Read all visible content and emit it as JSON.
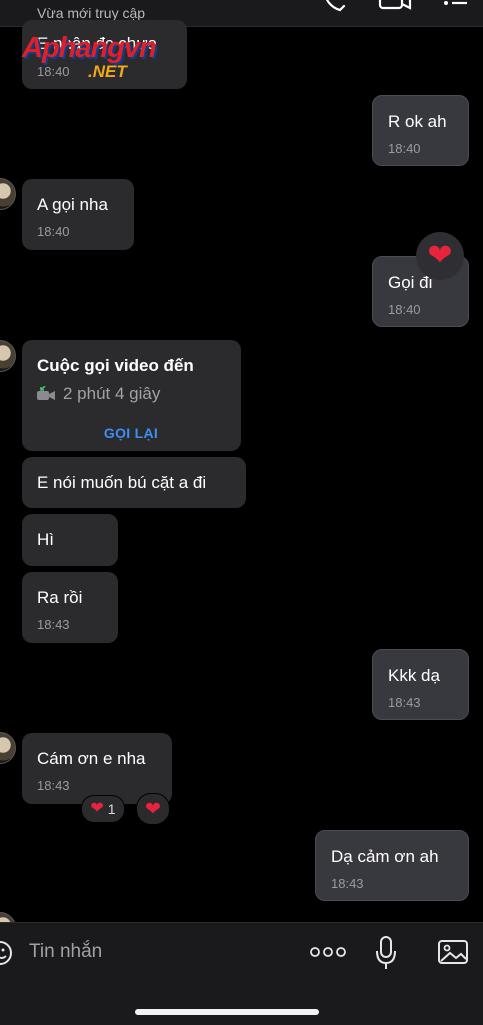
{
  "header": {
    "status": "Vừa mới truy cập",
    "icons": [
      "phone-icon",
      "video-icon",
      "more-icon"
    ]
  },
  "watermark": {
    "top": "Aphangvn",
    "bottom": ".NET"
  },
  "messages": [
    {
      "id": "m1",
      "direction": "in",
      "text": "E nhận đc chưa",
      "time": "18:40"
    },
    {
      "id": "m2",
      "direction": "out",
      "text": "R ok ah",
      "time": "18:40"
    },
    {
      "id": "m3",
      "direction": "in",
      "text": "A gọi nha",
      "time": "18:40"
    },
    {
      "id": "m4",
      "direction": "out",
      "text": "Gọi đi",
      "time": "18:40",
      "reaction": "heart"
    },
    {
      "id": "m5",
      "direction": "in",
      "type": "call",
      "title": "Cuộc gọi video đến",
      "duration": "2 phút 4 giây",
      "action": "GỌI LẠI"
    },
    {
      "id": "m6",
      "direction": "in",
      "text": "E nói muốn bú cặt a đi"
    },
    {
      "id": "m7",
      "direction": "in",
      "text": "Hì"
    },
    {
      "id": "m8",
      "direction": "in",
      "text": "Ra rồi",
      "time": "18:43"
    },
    {
      "id": "m9",
      "direction": "out",
      "text": "Kkk dạ",
      "time": "18:43"
    },
    {
      "id": "m10",
      "direction": "in",
      "text": "Cám ơn e nha",
      "time": "18:43",
      "reaction_count": "1"
    },
    {
      "id": "m11",
      "direction": "out",
      "text": "Dạ cảm ơn ah",
      "time": "18:43"
    }
  ],
  "composer": {
    "placeholder": "Tin nhắn",
    "icons": [
      "sticker-icon",
      "more-options-icon",
      "microphone-icon",
      "image-icon"
    ]
  },
  "colors": {
    "background": "#000000",
    "incoming_bubble": "#2b2b2e",
    "outgoing_bubble": "#38383f",
    "accent": "#3d8ef5",
    "heart": "#e8243c"
  }
}
